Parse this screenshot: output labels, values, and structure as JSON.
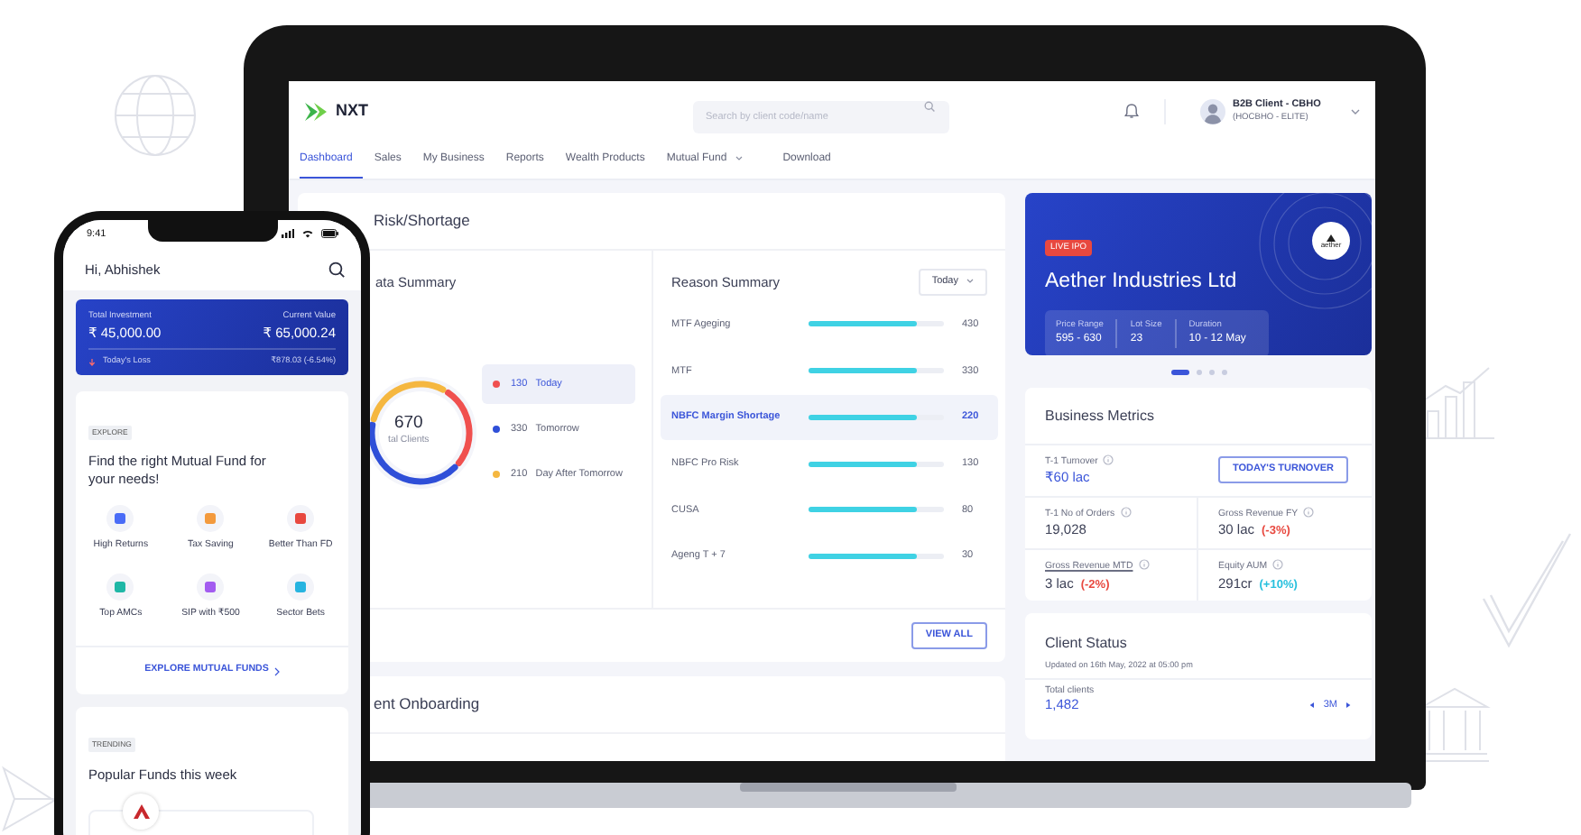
{
  "laptop": {
    "header": {
      "logo": "NXT",
      "search": {
        "placeholder": "Search by client code/name"
      },
      "user": {
        "name": "B2B Client - CBHO",
        "code": "(HOCBHO - ELITE)"
      }
    },
    "tabs": [
      {
        "label": "Dashboard",
        "selected": true,
        "has_menu": false
      },
      {
        "label": "Sales",
        "selected": false,
        "has_menu": false
      },
      {
        "label": "My Business",
        "selected": false,
        "has_menu": false
      },
      {
        "label": "Reports",
        "selected": false,
        "has_menu": false
      },
      {
        "label": "Wealth Products",
        "selected": false,
        "has_menu": false
      },
      {
        "label": "Mutual Fund",
        "selected": false,
        "has_menu": true
      },
      {
        "label": "Download",
        "selected": false,
        "has_menu": false
      }
    ],
    "risk_card": {
      "title": "Risk/Shortage",
      "data_summary": {
        "title": "ata Summary",
        "total": "670",
        "total_label": "tal Clients",
        "legend": [
          {
            "value": "130",
            "label": "Today",
            "color": "#f0504f",
            "selected": true
          },
          {
            "value": "330",
            "label": "Tomorrow",
            "color": "#2f4fd8",
            "selected": false
          },
          {
            "value": "210",
            "label": "Day After Tomorrow",
            "color": "#f5b740",
            "selected": false
          }
        ]
      },
      "reason_summary": {
        "title": "Reason Summary",
        "period": "Today",
        "rows": [
          {
            "label": "MTF Ageging",
            "value": "430",
            "level": 0.8,
            "selected": false
          },
          {
            "label": "MTF",
            "value": "330",
            "level": 0.8,
            "selected": false
          },
          {
            "label": "NBFC Margin Shortage",
            "value": "220",
            "level": 0.8,
            "selected": true
          },
          {
            "label": "NBFC Pro Risk",
            "value": "130",
            "level": 0.8,
            "selected": false
          },
          {
            "label": "CUSA",
            "value": "80",
            "level": 0.8,
            "selected": false
          },
          {
            "label": "Ageng T + 7",
            "value": "30",
            "level": 0.8,
            "selected": false
          }
        ]
      },
      "action": "VIEW ALL"
    },
    "onboarding_card": {
      "title": "ent Onboarding"
    },
    "ipo_banner": {
      "badge": "LIVE IPO",
      "company": "Aether Industries Ltd",
      "logo_text": "aether",
      "stats": [
        {
          "label": "Price Range",
          "value": "595 - 630"
        },
        {
          "label": "Lot Size",
          "value": "23"
        },
        {
          "label": "Duration",
          "value": "10 - 12 May"
        }
      ]
    },
    "carousel_dots": [
      {
        "selected": true
      },
      {
        "selected": false
      },
      {
        "selected": false
      },
      {
        "selected": false
      }
    ],
    "business_metrics": {
      "title": "Business Metrics",
      "turnover": {
        "label": "T-1 Turnover",
        "value": "₹60 lac"
      },
      "action": "TODAY'S TURNOVER",
      "metrics": [
        {
          "label": "T-1 No of Orders",
          "value": "19,028",
          "underlined": false
        },
        {
          "label": "Gross Revenue FY",
          "value": "30 lac",
          "change": "(-3%)",
          "color": "#e8483f",
          "underlined": false
        },
        {
          "label": "Gross Revenue MTD",
          "value": "3 lac",
          "change": "(-2%)",
          "color": "#e8483f",
          "underlined": true
        },
        {
          "label": "Equity AUM",
          "value": "291cr",
          "change": "(+10%)",
          "color": "#27c0dd",
          "underlined": false
        }
      ]
    },
    "client_status": {
      "title": "Client Status",
      "updated": "Updated on 16th May, 2022 at 05:00 pm",
      "total_label": "Total clients",
      "total": "1,482",
      "period": "3M"
    }
  },
  "phone": {
    "time": "9:41",
    "greeting": "Hi, Abhishek",
    "portfolio": {
      "invested_label": "Total Investment",
      "invested": "₹ 45,000.00",
      "current_label": "Current Value",
      "current": "₹ 65,000.24",
      "day_label": "Today's Loss",
      "day_change": "₹878.03 (-6.54%)"
    },
    "explore": {
      "tag": "EXPLORE",
      "title": "Find the right Mutual Fund for your needs!",
      "categories": [
        {
          "label": "High Returns",
          "color": "#4a6cf7"
        },
        {
          "label": "Tax Saving",
          "color": "#f39a3d"
        },
        {
          "label": "Better Than FD",
          "color": "#e8483f"
        },
        {
          "label": "Top AMCs",
          "color": "#1fb7a6"
        },
        {
          "label": "SIP with ₹500",
          "color": "#a35cf0"
        },
        {
          "label": "Sector Bets",
          "color": "#27b4e0"
        }
      ],
      "action": "EXPLORE MUTUAL FUNDS"
    },
    "trending": {
      "tag": "TRENDING",
      "title": "Popular Funds this week"
    }
  }
}
